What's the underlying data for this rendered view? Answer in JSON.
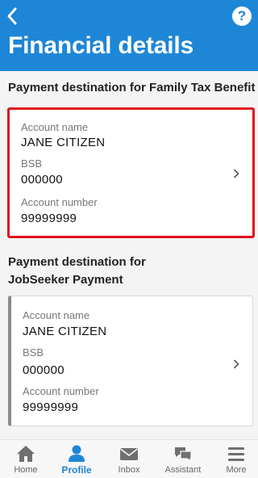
{
  "header": {
    "title": "Financial details"
  },
  "sections": [
    {
      "title": "Payment destination for Family Tax Benefit",
      "account_name_label": "Account name",
      "account_name": "JANE  CITIZEN",
      "bsb_label": "BSB",
      "bsb": "000000",
      "account_number_label": "Account number",
      "account_number": "99999999"
    },
    {
      "title_line1": "Payment destination for",
      "title_line2": "JobSeeker Payment",
      "account_name_label": "Account name",
      "account_name": "JANE  CITIZEN",
      "bsb_label": "BSB",
      "bsb": "000000",
      "account_number_label": "Account number",
      "account_number": "99999999"
    }
  ],
  "nav": {
    "items": [
      {
        "label": "Home",
        "icon": "home-icon"
      },
      {
        "label": "Profile",
        "icon": "profile-icon",
        "active": true
      },
      {
        "label": "Inbox",
        "icon": "inbox-icon"
      },
      {
        "label": "Assistant",
        "icon": "assistant-icon"
      },
      {
        "label": "More",
        "icon": "menu-icon"
      }
    ]
  },
  "colors": {
    "header_bg": "#1e86d6",
    "highlight_border": "#e0121c",
    "active_nav": "#1e86d6"
  }
}
